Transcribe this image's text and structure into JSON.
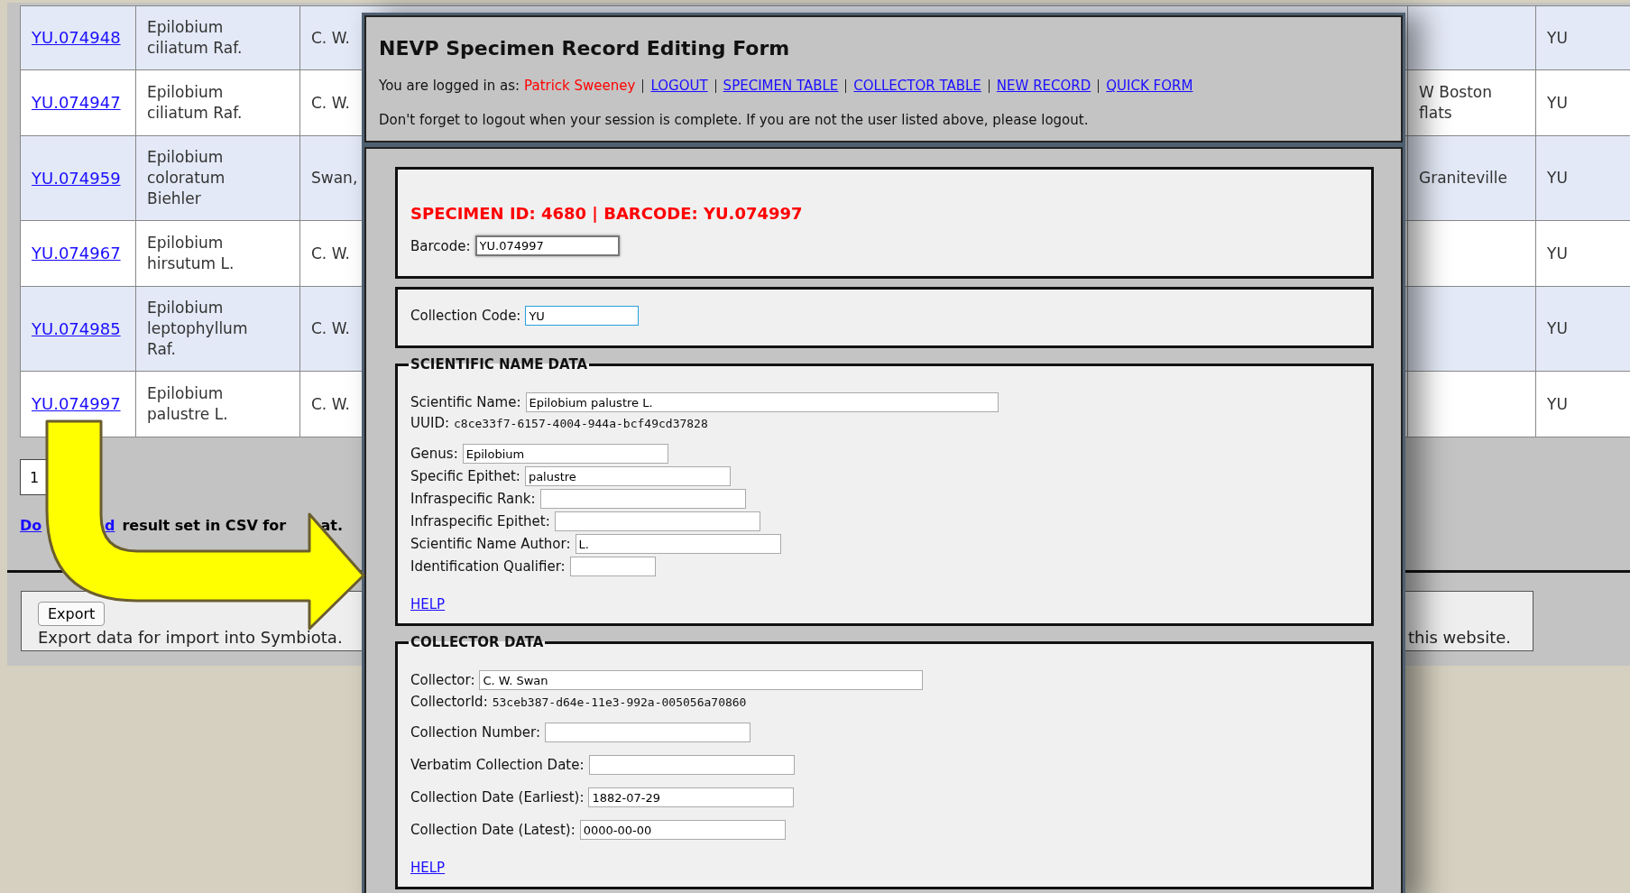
{
  "table": {
    "rows": [
      {
        "link": "YU.074948",
        "column_2": "Epilobium ciliatum Raf.",
        "column_3": "C. W.",
        "column_5": "YU"
      },
      {
        "link": "YU.074947",
        "column_2": "Epilobium ciliatum Raf.",
        "column_3": "C. W.",
        "column_4": "W Boston flats",
        "column_5": "YU"
      },
      {
        "link": "YU.074959",
        "column_2": "Epilobium coloratum Biehler",
        "column_3": "Swan,",
        "column_4": "Graniteville",
        "column_5": "YU"
      },
      {
        "link": "YU.074967",
        "column_2": "Epilobium hirsutum L.",
        "column_3": "C. W.",
        "column_5": "YU"
      },
      {
        "link": "YU.074985",
        "column_2": "Epilobium leptophyllum Raf.",
        "column_3": "C. W.",
        "column_5": "YU"
      },
      {
        "link": "YU.074997",
        "column_2": "Epilobium palustre L.",
        "column_3": "C. W.",
        "column_5": "YU"
      }
    ]
  },
  "pagination": {
    "pages": [
      "1"
    ]
  },
  "download": {
    "link_parts": [
      "Do",
      "d"
    ],
    "text_parts": [
      "result set in CSV for",
      "at."
    ]
  },
  "export": {
    "button": "Export",
    "description": "Export data for import into Symbiota.",
    "note": "this website."
  },
  "form": {
    "title": "NEVP Specimen Record Editing Form",
    "login": {
      "prefix": "You are logged in as:",
      "user": "Patrick Sweeney",
      "links": [
        "LOGOUT",
        "SPECIMEN TABLE",
        "COLLECTOR TABLE",
        "NEW RECORD",
        "QUICK FORM"
      ]
    },
    "reminder": "Don't forget to logout when your session is complete. If you are not the user listed above, please logout.",
    "sections": [
      {
        "heading": "SPECIMEN ID: 4680 | BARCODE: YU.074997",
        "groups": [
          [
            {
              "kind": "field",
              "label": "Barcode:",
              "value": "YU.074997"
            }
          ]
        ]
      },
      {
        "groups": [
          [
            {
              "kind": "field",
              "label": "Collection Code:",
              "value": "YU"
            }
          ]
        ]
      },
      {
        "legend": "SCIENTIFIC NAME DATA",
        "groups": [
          [
            {
              "kind": "field",
              "label": "Scientific Name:",
              "value": "Epilobium palustre L."
            },
            {
              "kind": "info",
              "label": "UUID:",
              "value": "c8ce33f7-6157-4004-944a-bcf49cd37828"
            }
          ],
          [
            {
              "kind": "field",
              "label": "Genus:",
              "value": "Epilobium"
            },
            {
              "kind": "field",
              "label": "Specific Epithet:",
              "value": "palustre"
            },
            {
              "kind": "field",
              "label": "Infraspecific Rank:"
            },
            {
              "kind": "field",
              "label": "Infraspecific Epithet:"
            },
            {
              "kind": "field",
              "label": "Scientific Name Author:",
              "value": "L."
            },
            {
              "kind": "field",
              "label": "Identification Qualifier:"
            }
          ]
        ],
        "help": "HELP"
      },
      {
        "legend": "COLLECTOR DATA",
        "groups": [
          [
            {
              "kind": "field",
              "label": "Collector:",
              "value": "C. W. Swan"
            },
            {
              "kind": "info",
              "label": "CollectorId:",
              "value": "53ceb387-d64e-11e3-992a-005056a70860"
            }
          ],
          [
            {
              "kind": "field",
              "label": "Collection Number:"
            }
          ],
          [
            {
              "kind": "field",
              "label": "Verbatim Collection Date:"
            }
          ],
          [
            {
              "kind": "field",
              "label": "Collection Date (Earliest):",
              "value": "1882-07-29"
            }
          ],
          [
            {
              "kind": "field",
              "label": "Collection Date (Latest):",
              "value": "0000-00-00"
            }
          ]
        ],
        "help": "HELP"
      }
    ]
  }
}
